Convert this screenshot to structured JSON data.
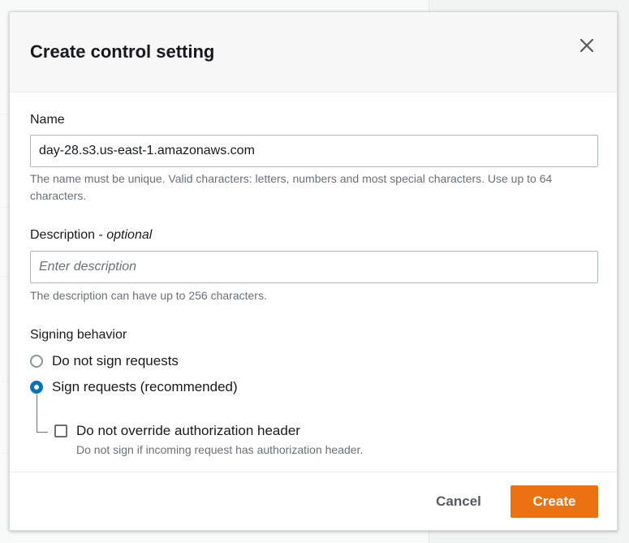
{
  "modal": {
    "title": "Create control setting",
    "close_icon": "close-icon"
  },
  "name_field": {
    "label": "Name",
    "value": "day-28.s3.us-east-1.amazonaws.com",
    "help": "The name must be unique. Valid characters: letters, numbers and most special characters. Use up to 64 characters."
  },
  "description_field": {
    "label": "Description",
    "label_optional": "optional",
    "placeholder": "Enter description",
    "value": "",
    "help": "The description can have up to 256 characters."
  },
  "signing": {
    "label": "Signing behavior",
    "options": [
      {
        "label": "Do not sign requests",
        "checked": false
      },
      {
        "label": "Sign requests (recommended)",
        "checked": true
      }
    ],
    "override_checkbox": {
      "label": "Do not override authorization header",
      "description": "Do not sign if incoming request has authorization header.",
      "checked": false
    }
  },
  "footer": {
    "cancel_label": "Cancel",
    "create_label": "Create"
  },
  "colors": {
    "primary_button": "#ec7211",
    "radio_selected": "#0073bb",
    "text": "#16191f",
    "help_text": "#687078"
  }
}
